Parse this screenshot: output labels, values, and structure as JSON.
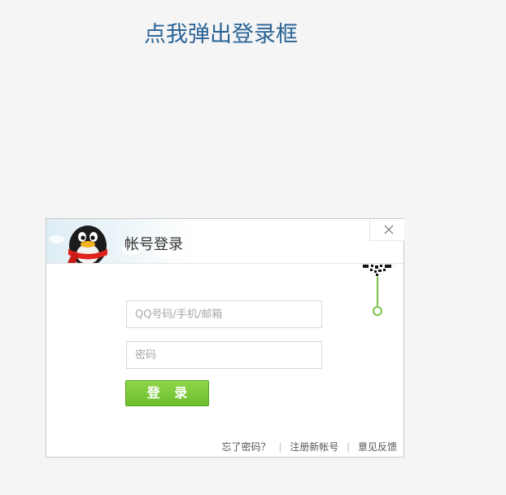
{
  "page": {
    "popup_link": "点我弹出登录框"
  },
  "dialog": {
    "title": "帐号登录",
    "account_placeholder": "QQ号码/手机/邮箱",
    "password_placeholder": "密码",
    "login_button": "登 录",
    "footer": {
      "forgot_password": "忘了密码？",
      "register": "注册新帐号",
      "feedback": "意见反馈",
      "separator": "|"
    }
  },
  "colors": {
    "link": "#2a6496",
    "login_button": "#74c436",
    "qr_line": "#7cc24a"
  },
  "icons": {
    "mascot": "qq-penguin-icon",
    "close": "close-icon",
    "qr": "qr-code-icon"
  }
}
